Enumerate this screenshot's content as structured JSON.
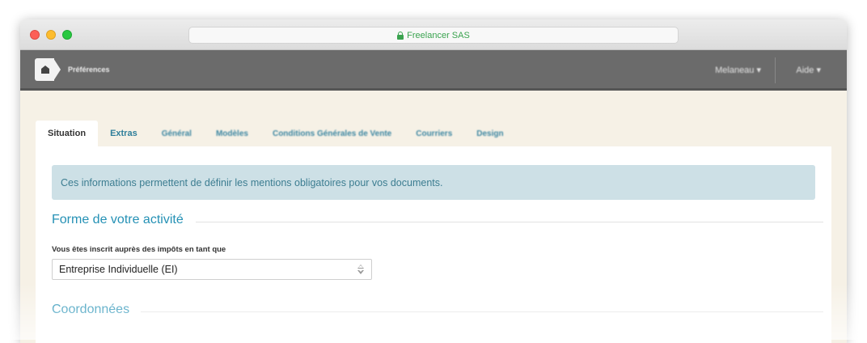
{
  "browser": {
    "url_text": "Freelancer SAS"
  },
  "appbar": {
    "title": "Préférences",
    "user_menu": "Melaneau ▾",
    "help_menu": "Aide ▾"
  },
  "tabs": [
    {
      "label": "Situation"
    },
    {
      "label": "Extras"
    },
    {
      "label": "Général"
    },
    {
      "label": "Modèles"
    },
    {
      "label": "Conditions Générales de Vente"
    },
    {
      "label": "Courriers"
    },
    {
      "label": "Design"
    }
  ],
  "main": {
    "info_message": "Ces informations permettent de définir les mentions obligatoires pour vos documents.",
    "section_activity_title": "Forme de votre activité",
    "tax_label": "Vous êtes inscrit auprès des impôts en tant que",
    "tax_value": "Entreprise Individuelle (EI)",
    "section_contact_title": "Coordonnées"
  },
  "colors": {
    "accent": "#2591b5",
    "info_bg": "#cde0e6",
    "appbar_bg": "#6b6b6b",
    "content_bg": "#f6f1e6"
  },
  "icons": [
    "lock-icon",
    "logo-icon",
    "updown-icon"
  ]
}
